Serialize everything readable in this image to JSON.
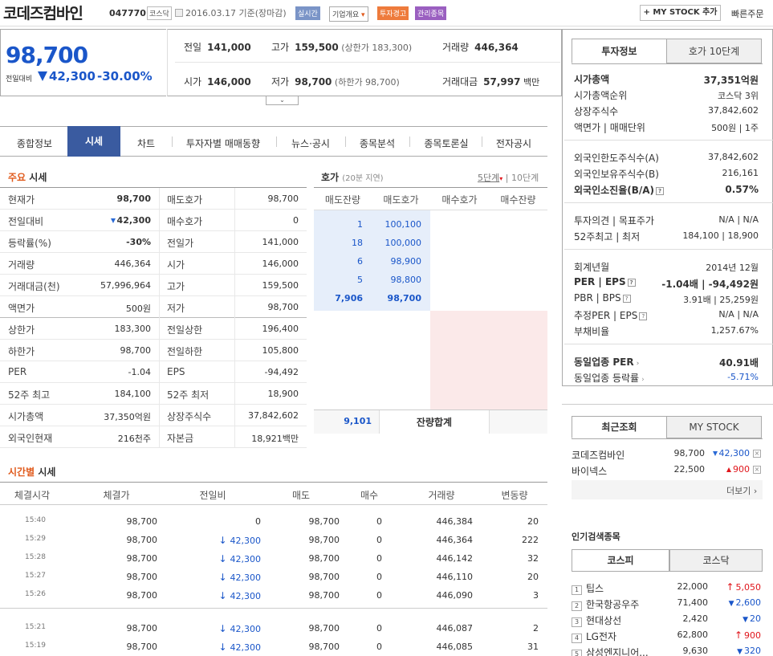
{
  "header": {
    "name": "코데즈컴바인",
    "code": "047770",
    "market": "코스닥",
    "date": "2016.03.17 기준(장마감)",
    "tags": [
      "실시간",
      "기업개요",
      "투자경고",
      "관리종목"
    ],
    "my_stock_btn": "+ MY STOCK 추가",
    "quick_order": "빠른주문"
  },
  "price": {
    "current": "98,700",
    "change_label": "전일대비",
    "change": "42,300",
    "change_pct": "-30.00%"
  },
  "quote_top": [
    {
      "label": "전일",
      "value": "141,000"
    },
    {
      "label": "고가",
      "value": "159,500",
      "sub": "(상한가 183,300)"
    },
    {
      "label": "거래량",
      "value": "446,364"
    },
    {
      "label": "시가",
      "value": "146,000"
    },
    {
      "label": "저가",
      "value": "98,700",
      "sub": "(하한가 98,700)"
    },
    {
      "label": "거래대금",
      "value": "57,997",
      "unit": "백만"
    }
  ],
  "tabs": [
    "종합정보",
    "시세",
    "차트",
    "투자자별 매매동향",
    "뉴스·공시",
    "종목분석",
    "종목토론실",
    "전자공시"
  ],
  "main_title": {
    "a": "주요",
    "b": "시세"
  },
  "main_left": [
    [
      "현재가",
      "98,700"
    ],
    [
      "전일대비",
      "42,300"
    ],
    [
      "등락률(%)",
      "-30%"
    ],
    [
      "거래량",
      "446,364"
    ],
    [
      "거래대금(천)",
      "57,996,964"
    ],
    [
      "액면가",
      "500원"
    ],
    [
      "상한가",
      "183,300"
    ],
    [
      "하한가",
      "98,700"
    ],
    [
      "PER",
      "-1.04"
    ],
    [
      "52주 최고",
      "184,100"
    ],
    [
      "시가총액",
      "37,350억원"
    ],
    [
      "외국인현재",
      "216천주"
    ]
  ],
  "main_right": [
    [
      "매도호가",
      "98,700"
    ],
    [
      "매수호가",
      "0"
    ],
    [
      "전일가",
      "141,000"
    ],
    [
      "시가",
      "146,000"
    ],
    [
      "고가",
      "159,500"
    ],
    [
      "저가",
      "98,700"
    ],
    [
      "전일상한",
      "196,400"
    ],
    [
      "전일하한",
      "105,800"
    ],
    [
      "EPS",
      "-94,492"
    ],
    [
      "52주 최저",
      "18,900"
    ],
    [
      "상장주식수",
      "37,842,602"
    ],
    [
      "자본금",
      "18,921백만"
    ]
  ],
  "hoga": {
    "title": "호가",
    "note": "(20분 지연)",
    "link5": "5단계",
    "link10": "10단계",
    "headers": [
      "매도잔량",
      "매도호가",
      "매수호가",
      "매수잔량"
    ],
    "rows": [
      [
        "1",
        "100,100"
      ],
      [
        "18",
        "100,000"
      ],
      [
        "6",
        "98,900"
      ],
      [
        "5",
        "98,800"
      ],
      [
        "7,906",
        "98,700"
      ]
    ],
    "total": "9,101",
    "total_label": "잔량합계"
  },
  "time_title": {
    "a": "시간별",
    "b": "시세"
  },
  "time_headers": [
    "체결시각",
    "체결가",
    "전일비",
    "매도",
    "매수",
    "거래량",
    "변동량"
  ],
  "time_rows": [
    [
      "15:40",
      "98,700",
      "0",
      "98,700",
      "0",
      "446,384",
      "20"
    ],
    [
      "15:29",
      "98,700",
      "42,300",
      "98,700",
      "0",
      "446,364",
      "222"
    ],
    [
      "15:28",
      "98,700",
      "42,300",
      "98,700",
      "0",
      "446,142",
      "32"
    ],
    [
      "15:27",
      "98,700",
      "42,300",
      "98,700",
      "0",
      "446,110",
      "20"
    ],
    [
      "15:26",
      "98,700",
      "42,300",
      "98,700",
      "0",
      "446,090",
      "3"
    ],
    [
      "15:21",
      "98,700",
      "42,300",
      "98,700",
      "0",
      "446,087",
      "2"
    ],
    [
      "15:19",
      "98,700",
      "42,300",
      "98,700",
      "0",
      "446,085",
      "31"
    ]
  ],
  "right": {
    "tab1": "투자정보",
    "tab2": "호가 10단계",
    "g1": [
      [
        "시가총액",
        "37,351억원"
      ],
      [
        "시가총액순위",
        "코스닥 3위"
      ],
      [
        "상장주식수",
        "37,842,602"
      ],
      [
        "액면가 | 매매단위",
        "500원 | 1주"
      ]
    ],
    "g2": [
      [
        "외국인한도주식수(A)",
        "37,842,602"
      ],
      [
        "외국인보유주식수(B)",
        "216,161"
      ],
      [
        "외국인소진율(B/A)",
        "0.57%"
      ]
    ],
    "g3": [
      [
        "투자의견 | 목표주가",
        "N/A | N/A"
      ],
      [
        "52주최고 | 최저",
        "184,100 | 18,900"
      ]
    ],
    "g4": [
      [
        "회계년월",
        "2014년 12월"
      ],
      [
        "PER | EPS",
        "-1.04배 | -94,492원"
      ],
      [
        "PBR | BPS",
        "3.91배 | 25,259원"
      ],
      [
        "추정PER | EPS",
        "N/A | N/A"
      ],
      [
        "부채비율",
        "1,257.67%"
      ]
    ],
    "g5": [
      [
        "동일업종 PER",
        "40.91배"
      ],
      [
        "동일업종 등락률",
        "-5.71%"
      ]
    ]
  },
  "recent": {
    "tab1": "최근조회",
    "tab2": "MY STOCK",
    "items": [
      [
        "코데즈컴바인",
        "98,700",
        "42,300"
      ],
      [
        "바이넥스",
        "22,500",
        "900"
      ]
    ],
    "more": "더보기"
  },
  "popular": {
    "title": "인기검색종목",
    "tab1": "코스피",
    "tab2": "코스닥",
    "items": [
      [
        "1",
        "팁스",
        "22,000",
        "5,050"
      ],
      [
        "2",
        "한국항공우주",
        "71,400",
        "2,600"
      ],
      [
        "3",
        "현대상선",
        "2,420",
        "20"
      ],
      [
        "4",
        "LG전자",
        "62,800",
        "900"
      ],
      [
        "5",
        "삼성엔지니어...",
        "9,630",
        "320"
      ]
    ]
  }
}
